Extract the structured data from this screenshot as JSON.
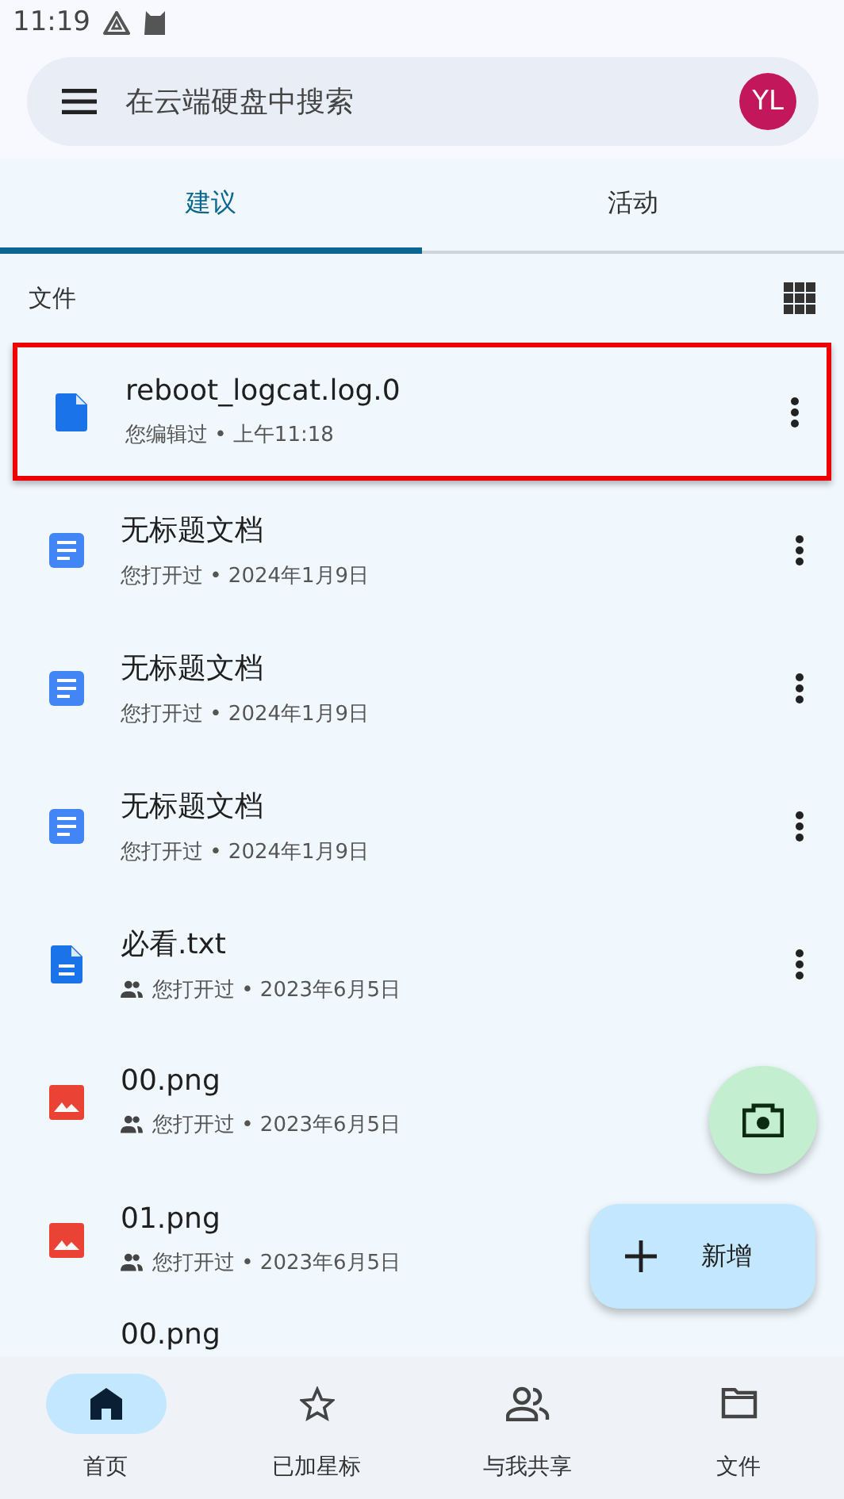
{
  "status_bar": {
    "time": "11:19"
  },
  "search": {
    "placeholder": "在云端硬盘中搜索",
    "avatar": "YL"
  },
  "tabs": [
    {
      "label": "建议",
      "selected": true
    },
    {
      "label": "活动",
      "selected": false
    }
  ],
  "section": {
    "title": "文件"
  },
  "files": [
    {
      "name": "reboot_logcat.log.0",
      "meta": "您编辑过 • 上午11:18",
      "kind": "file",
      "shared": false,
      "menu": true,
      "highlighted": true
    },
    {
      "name": "无标题文档",
      "meta": "您打开过 • 2024年1月9日",
      "kind": "doc",
      "shared": false,
      "menu": true,
      "highlighted": false
    },
    {
      "name": "无标题文档",
      "meta": "您打开过 • 2024年1月9日",
      "kind": "doc",
      "shared": false,
      "menu": true,
      "highlighted": false
    },
    {
      "name": "无标题文档",
      "meta": "您打开过 • 2024年1月9日",
      "kind": "doc",
      "shared": false,
      "menu": true,
      "highlighted": false
    },
    {
      "name": "必看.txt",
      "meta": "您打开过 • 2023年6月5日",
      "kind": "text",
      "shared": true,
      "menu": true,
      "highlighted": false
    },
    {
      "name": "00.png",
      "meta": "您打开过 • 2023年6月5日",
      "kind": "image",
      "shared": true,
      "menu": false,
      "highlighted": false
    },
    {
      "name": "01.png",
      "meta": "您打开过 • 2023年6月5日",
      "kind": "image",
      "shared": true,
      "menu": false,
      "highlighted": false
    },
    {
      "name": "00.png",
      "kind": "partial"
    }
  ],
  "fab": {
    "label": "新增"
  },
  "nav": [
    {
      "label": "首页",
      "selected": true
    },
    {
      "label": "已加星标",
      "selected": false
    },
    {
      "label": "与我共享",
      "selected": false
    },
    {
      "label": "文件",
      "selected": false
    }
  ]
}
